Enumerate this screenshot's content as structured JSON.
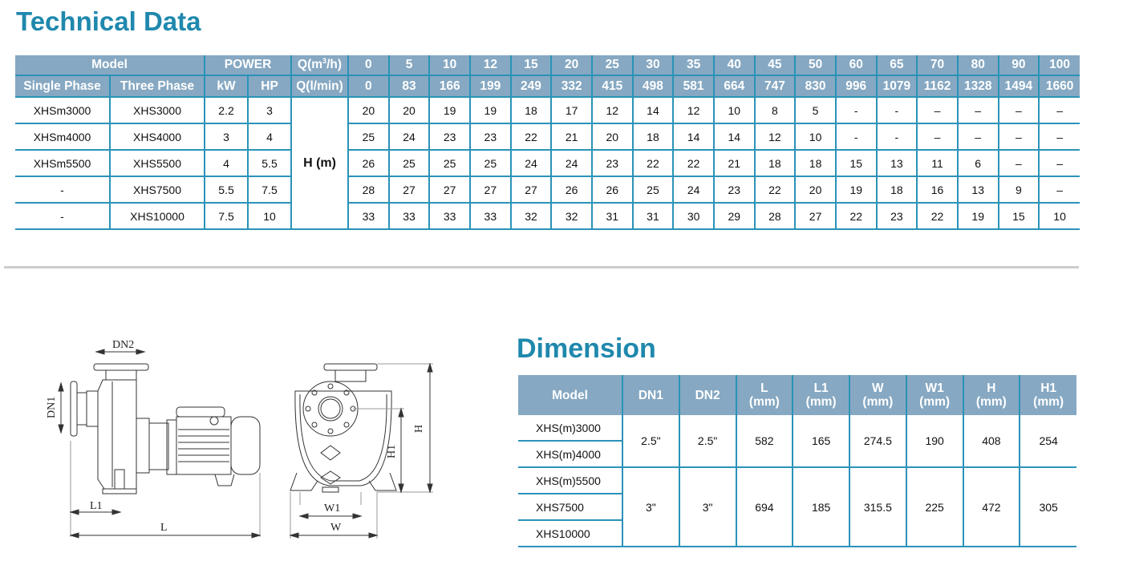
{
  "technical_data": {
    "title": "Technical Data",
    "header": {
      "model_label": "Model",
      "power_label": "POWER",
      "q_m3h_label_prefix": "Q(m",
      "q_m3h_label_sup": "3",
      "q_m3h_label_suffix": "/h)",
      "single_phase_label": "Single Phase",
      "three_phase_label": "Three Phase",
      "kw_label": "kW",
      "hp_label": "HP",
      "q_lmin_label": "Q(l/min)"
    },
    "flow_m3h": [
      "0",
      "5",
      "10",
      "12",
      "15",
      "20",
      "25",
      "30",
      "35",
      "40",
      "45",
      "50",
      "60",
      "65",
      "70",
      "80",
      "90",
      "100"
    ],
    "flow_lmin": [
      "0",
      "83",
      "166",
      "199",
      "249",
      "332",
      "415",
      "498",
      "581",
      "664",
      "747",
      "830",
      "996",
      "1079",
      "1162",
      "1328",
      "1494",
      "1660"
    ],
    "head_label": "H (m)",
    "rows": [
      {
        "single_phase": "XHSm3000",
        "three_phase": "XHS3000",
        "kw": "2.2",
        "hp": "3",
        "head": [
          "20",
          "20",
          "19",
          "19",
          "18",
          "17",
          "12",
          "14",
          "12",
          "10",
          "8",
          "5",
          "-",
          "-",
          "–",
          "–",
          "–",
          "–"
        ]
      },
      {
        "single_phase": "XHSm4000",
        "three_phase": "XHS4000",
        "kw": "3",
        "hp": "4",
        "head": [
          "25",
          "24",
          "23",
          "23",
          "22",
          "21",
          "20",
          "18",
          "14",
          "14",
          "12",
          "10",
          "-",
          "-",
          "–",
          "–",
          "–",
          "–"
        ]
      },
      {
        "single_phase": "XHSm5500",
        "three_phase": "XHS5500",
        "kw": "4",
        "hp": "5.5",
        "head": [
          "26",
          "25",
          "25",
          "25",
          "24",
          "24",
          "23",
          "22",
          "22",
          "21",
          "18",
          "18",
          "15",
          "13",
          "11",
          "6",
          "–",
          "–"
        ]
      },
      {
        "single_phase": "-",
        "three_phase": "XHS7500",
        "kw": "5.5",
        "hp": "7.5",
        "head": [
          "28",
          "27",
          "27",
          "27",
          "27",
          "26",
          "26",
          "25",
          "24",
          "23",
          "22",
          "20",
          "19",
          "18",
          "16",
          "13",
          "9",
          "–"
        ]
      },
      {
        "single_phase": "-",
        "three_phase": "XHS10000",
        "kw": "7.5",
        "hp": "10",
        "head": [
          "33",
          "33",
          "33",
          "33",
          "32",
          "32",
          "31",
          "31",
          "30",
          "29",
          "28",
          "27",
          "22",
          "23",
          "22",
          "19",
          "15",
          "10"
        ]
      }
    ]
  },
  "dimension": {
    "title": "Dimension",
    "headers": [
      {
        "top": "Model",
        "bottom": ""
      },
      {
        "top": "DN1",
        "bottom": ""
      },
      {
        "top": "DN2",
        "bottom": ""
      },
      {
        "top": "L",
        "bottom": "(mm)"
      },
      {
        "top": "L1",
        "bottom": "(mm)"
      },
      {
        "top": "W",
        "bottom": "(mm)"
      },
      {
        "top": "W1",
        "bottom": "(mm)"
      },
      {
        "top": "H",
        "bottom": "(mm)"
      },
      {
        "top": "H1",
        "bottom": "(mm)"
      }
    ],
    "groups": [
      {
        "models": [
          "XHS(m)3000",
          "XHS(m)4000"
        ],
        "dn1": "2.5\"",
        "dn2": "2.5\"",
        "l": "582",
        "l1": "165",
        "w": "274.5",
        "w1": "190",
        "h": "408",
        "h1": "254"
      },
      {
        "models": [
          "XHS(m)5500",
          "XHS7500",
          "XHS10000"
        ],
        "dn1": "3\"",
        "dn2": "3\"",
        "l": "694",
        "l1": "185",
        "w": "315.5",
        "w1": "225",
        "h": "472",
        "h1": "305"
      }
    ]
  },
  "drawings": {
    "side_view_labels": {
      "dn2": "DN2",
      "dn1": "DN1",
      "l1": "L1",
      "l": "L"
    },
    "front_view_labels": {
      "h": "H",
      "h1": "H1",
      "w1": "W1",
      "w": "W"
    }
  }
}
